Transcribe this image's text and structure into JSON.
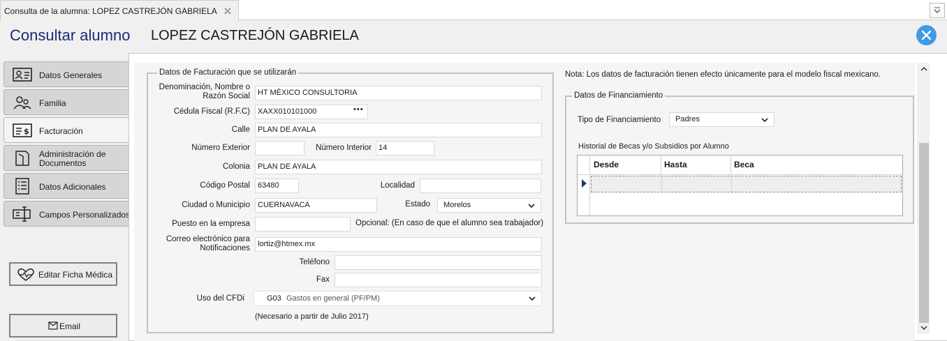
{
  "window_tab": {
    "title": "Consulta de la alumna: LOPEZ CASTREJÓN GABRIELA"
  },
  "header": {
    "title": "Consultar alumno",
    "student_name": "LOPEZ CASTREJÓN GABRIELA"
  },
  "sidebar": {
    "items": [
      {
        "label": "Datos Generales",
        "icon": "id-card-icon"
      },
      {
        "label": "Familia",
        "icon": "family-icon"
      },
      {
        "label": "Facturación",
        "icon": "invoice-icon",
        "active": true
      },
      {
        "label": "Administración de Documentos",
        "line1": "Administración de",
        "line2": "Documentos",
        "icon": "documents-icon"
      },
      {
        "label": "Datos Adicionales",
        "icon": "list-icon"
      },
      {
        "label": "Campos Personalizados",
        "icon": "custom-fields-icon"
      }
    ],
    "medical_button": "Editar Ficha Médica",
    "email_button": "Email"
  },
  "billing": {
    "legend": "Datos de Facturación que se utilizarán",
    "razon_social_label_1": "Denominación, Nombre o",
    "razon_social_label_2": "Razón Social",
    "razon_social": "HT MÉXICO CONSULTORIA",
    "rfc_label": "Cédula Fiscal (R.F.C)",
    "rfc": "XAXX010101000",
    "rfc_button": "•••",
    "calle_label": "Calle",
    "calle": "PLAN DE AYALA",
    "num_ext_label": "Número Exterior",
    "num_ext": "",
    "num_int_label": "Número Interior",
    "num_int": "14",
    "colonia_label": "Colonia",
    "colonia": "PLAN DE AYALA",
    "cp_label": "Código Postal",
    "cp": "63480",
    "localidad_label": "Localidad",
    "localidad": "",
    "ciudad_label": "Ciudad o Municipio",
    "ciudad": "CUERNAVACA",
    "estado_label": "Estado",
    "estado": "Morelos",
    "puesto_label": "Puesto en la empresa",
    "puesto": "",
    "puesto_note": "Opcional: (En caso de que el alumno sea trabajador)",
    "correo_label_1": "Correo electrónico para",
    "correo_label_2": "Notificaciones",
    "correo": "lortiz@htmex.mx",
    "telefono_label": "Teléfono",
    "telefono": "",
    "fax_label": "Fax",
    "fax": "",
    "cfdi_label": "Uso del CFDi",
    "cfdi_code": "G03",
    "cfdi_desc": "Gastos en general (PF/PM)",
    "cfdi_note": "(Necesario a partir de Julio 2017)"
  },
  "note": "Nota: Los datos de facturación tienen efecto únicamente para el modelo fiscal mexicano.",
  "financing": {
    "legend": "Datos de Financiamiento",
    "tipo_label": "Tipo de Financiamiento",
    "tipo": "Padres",
    "historial_label": "Historial de Becas y/o Subsidios por Alumno",
    "columns": [
      "Desde",
      "Hasta",
      "Beca"
    ]
  },
  "colors": {
    "title_blue": "#1b2a78",
    "close_blue": "#3f9ae8",
    "row_pointer": "#1f3b5c"
  }
}
